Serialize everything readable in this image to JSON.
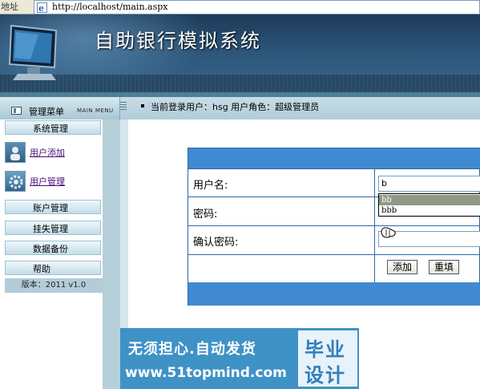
{
  "address_bar": {
    "label": "地址 (D)",
    "url": "http://localhost/main.aspx"
  },
  "banner": {
    "title": "自助银行模拟系统"
  },
  "menu_header": {
    "title": "管理菜单",
    "subtitle": "MAIN MENU",
    "user_info": "当前登录用户：hsg  用户角色：超级管理员"
  },
  "sidebar": {
    "section_system": "系统管理",
    "link_add_user": "用户添加",
    "link_manage_user": "用户管理",
    "section_account": "账户管理",
    "section_loss": "挂失管理",
    "section_backup": "数据备份",
    "section_help": "帮助",
    "version": "版本：2011 v1.0"
  },
  "form": {
    "username_label": "用户名:",
    "username_value": "b",
    "password_label": "密码:",
    "confirm_label": "确认密码:",
    "add_button": "添加",
    "reset_button": "重填",
    "autocomplete": [
      "bb",
      "bbb"
    ]
  },
  "watermark": {
    "line1": "无须担心.自动发货",
    "line2": "www.51topmind.com",
    "badge_top": "毕业",
    "badge_bottom": "设计"
  }
}
